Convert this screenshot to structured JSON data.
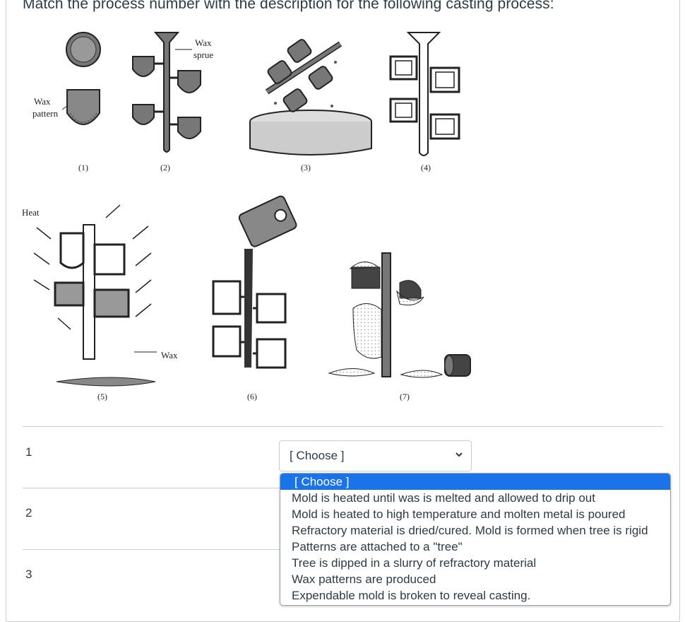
{
  "question": {
    "text": "Match the process number with the description for the following casting process:"
  },
  "figure": {
    "callouts": {
      "wax_sprue_line1": "Wax",
      "wax_sprue_line2": "sprue",
      "wax_pattern_line1": "Wax",
      "wax_pattern_line2": "pattern",
      "heat": "Heat",
      "wax_drip": "Wax"
    },
    "step_labels": [
      "(1)",
      "(2)",
      "(3)",
      "(4)",
      "(5)",
      "(6)",
      "(7)"
    ]
  },
  "rows": [
    {
      "number": "1"
    },
    {
      "number": "2"
    },
    {
      "number": "3"
    }
  ],
  "select": {
    "current_value": "[ Choose ]",
    "caret_icon": "chevron-down-icon"
  },
  "dropdown": {
    "options": [
      "[ Choose ]",
      "Mold is heated until was is melted and allowed to drip out",
      "Mold is heated to high temperature and molten metal is poured",
      "Refractory material is dried/cured. Mold is formed when tree is rigid",
      "Patterns are attached to a \"tree\"",
      "Tree is dipped in a slurry of refractory material",
      "Wax patterns are produced",
      "Expendable mold is broken to reveal casting."
    ],
    "highlighted_index": 0,
    "highlight_color": "#1a73e8"
  }
}
